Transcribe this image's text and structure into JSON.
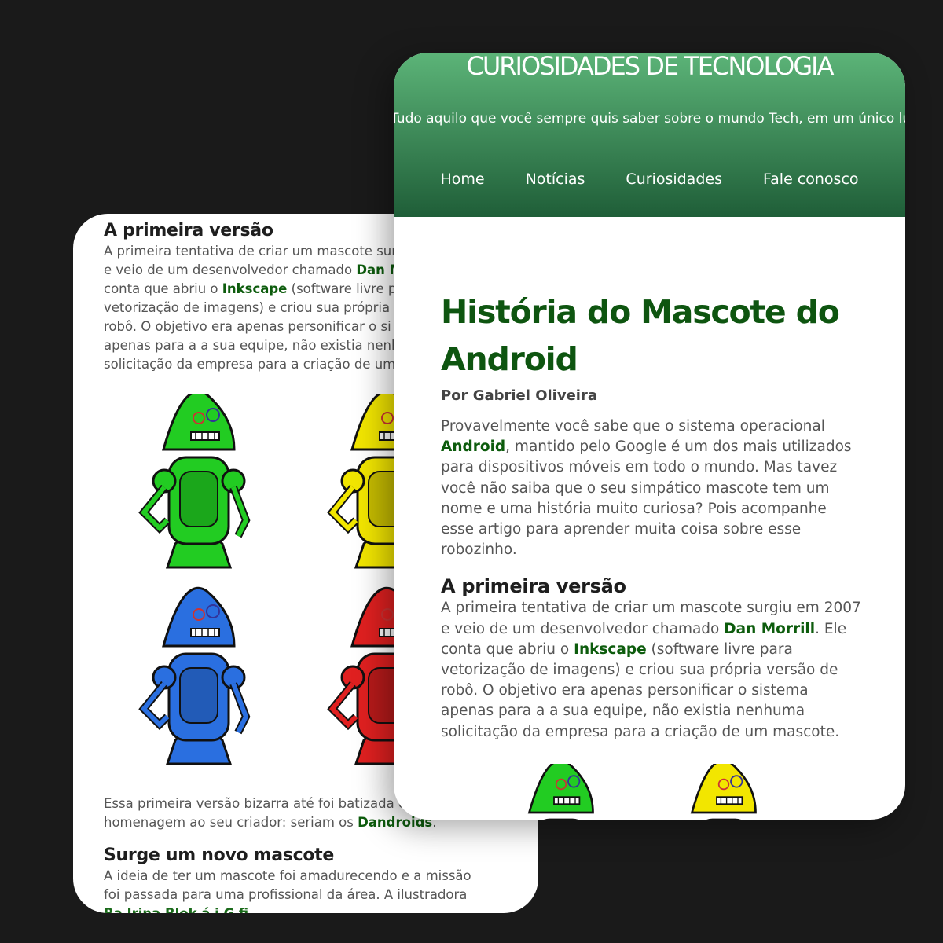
{
  "back_card": {
    "section1_heading": "A primeira versão",
    "section1_lines": [
      [
        "A primeira tentativa de criar um mascote sur"
      ],
      [
        "e veio de um desenvolvedor chamado ",
        "Dan M"
      ],
      [
        "conta que abriu o ",
        "Inkscape",
        " (software livre p"
      ],
      [
        "vetorização de imagens) e criou sua própria v"
      ],
      [
        "robô. O objetivo era apenas personificar o si"
      ],
      [
        "apenas para a a sua equipe, não existia nenh"
      ],
      [
        "solicitação da empresa para a criação de um"
      ]
    ],
    "para2_line1": "Essa primeira versão bizarra até foi batizada e",
    "para2_line2_pre": "homenagem ao seu criador: seriam os ",
    "para2_line2_kw": "Dandroids",
    "para2_line2_post": ".",
    "section2_heading": "Surge um novo mascote",
    "section2_line1": "A ideia de ter um mascote foi amadurecendo e a missão",
    "section2_line2": "foi passada para uma profissional da área. A ilustradora",
    "section2_line3": "Ba         Irina Blok         á         i         G        fi"
  },
  "front_card": {
    "site_title": "CURIOSIDADES DE TECNOLOGIA",
    "tagline": "Tudo aquilo que você sempre quis saber sobre o mundo Tech, em um único lugar",
    "nav": [
      "Home",
      "Notícias",
      "Curiosidades",
      "Fale conosco"
    ],
    "article_title": "História do Mascote do Android",
    "byline": "Por Gabriel Oliveira",
    "intro_lines": [
      [
        "Provavelmente você sabe que o sistema operacional"
      ],
      [
        "",
        "Android",
        ", mantido pelo Google é um dos mais utilizados"
      ],
      [
        "para dispositivos móveis em todo o mundo. Mas tavez"
      ],
      [
        "você não saiba que o seu simpático mascote tem um"
      ],
      [
        "nome e uma história muito curiosa? Pois acompanhe"
      ],
      [
        "esse artigo para aprender muita coisa sobre esse"
      ],
      [
        "robozinho."
      ]
    ],
    "section1_heading": "A primeira versão",
    "section1_lines": [
      [
        "A primeira tentativa de criar um mascote surgiu em 2007"
      ],
      [
        "e veio de um desenvolvedor chamado ",
        "Dan Morrill",
        ". Ele"
      ],
      [
        "conta que abriu o ",
        "Inkscape",
        " (software livre para"
      ],
      [
        "vetorização de imagens) e criou sua própria versão de"
      ],
      [
        "robô. O objetivo era apenas personificar o sistema"
      ],
      [
        "apenas para a a sua equipe, não existia nenhuma"
      ],
      [
        "solicitação da empresa para a criação de um mascote."
      ]
    ]
  },
  "colors": {
    "robot_green": "#22cc22",
    "robot_yellow": "#f2e600",
    "robot_blue": "#2a6fe0",
    "robot_red": "#e02020",
    "header_top": "#5cb478",
    "header_bottom": "#1f5e38",
    "title_green": "#0e5510"
  }
}
